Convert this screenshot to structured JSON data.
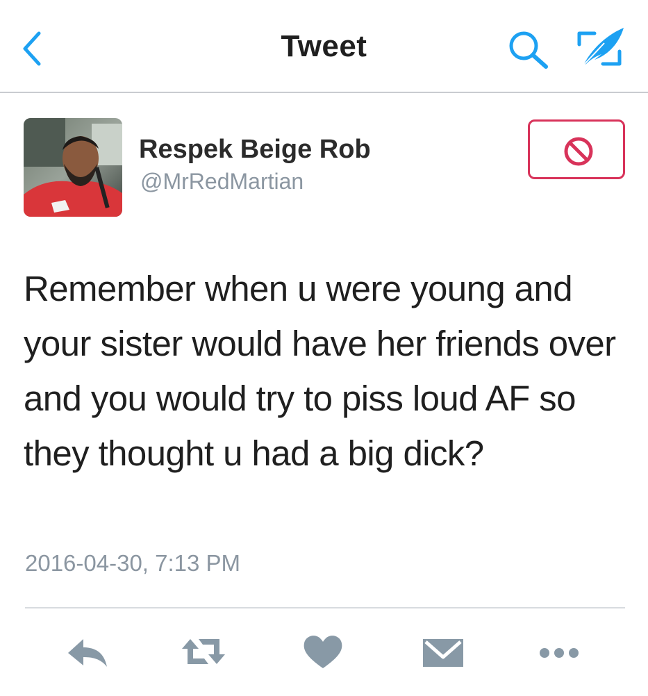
{
  "header": {
    "title": "Tweet",
    "back_icon": "chevron-left-icon",
    "search_icon": "search-icon",
    "compose_icon": "compose-tweet-icon",
    "accent_color": "#1da1f2"
  },
  "tweet": {
    "author": {
      "display_name": "Respek Beige Rob",
      "handle": "@MrRedMartian",
      "avatar_icon": "avatar-photo"
    },
    "blocked_button_icon": "block-icon",
    "blocked_color": "#d8335a",
    "text": "Remember when u were young and your sister would have her friends over and you would try to piss loud AF so they thought u had a big dick?",
    "timestamp": "2016-04-30, 7:13 PM"
  },
  "actions": {
    "icons": [
      "reply-icon",
      "retweet-icon",
      "like-icon",
      "direct-message-icon",
      "more-icon"
    ],
    "icon_color": "#8899a6"
  }
}
